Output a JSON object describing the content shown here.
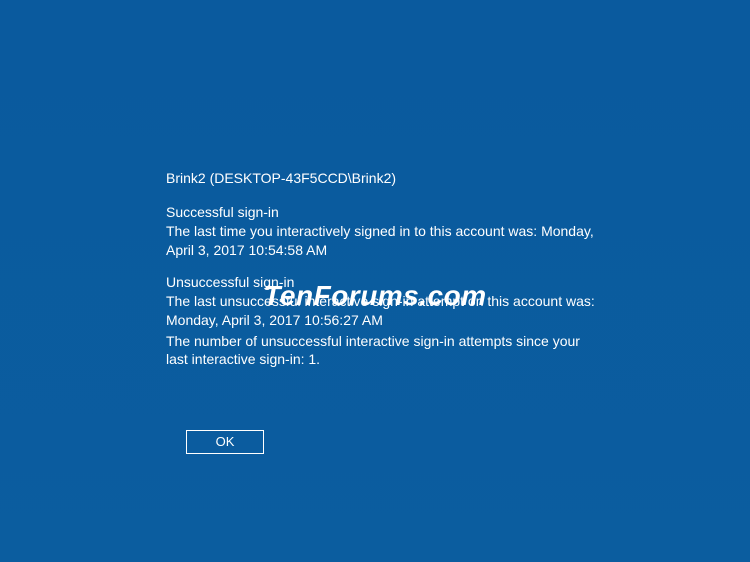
{
  "account": {
    "label": "Brink2 (DESKTOP-43F5CCD\\Brink2)"
  },
  "successful": {
    "header": "Successful sign-in",
    "text": "The last time you interactively signed in to this account was: Monday, April 3, 2017 10:54:58 AM"
  },
  "unsuccessful": {
    "header": "Unsuccessful sign-in",
    "text1": "The last unsuccessful interactive sign-in attempt on this account was: Monday, April 3, 2017 10:56:27 AM",
    "text2": "The number of unsuccessful interactive sign-in attempts since your last interactive sign-in: 1."
  },
  "button": {
    "ok_label": "OK"
  },
  "watermark": {
    "text": "TenForums.com"
  }
}
